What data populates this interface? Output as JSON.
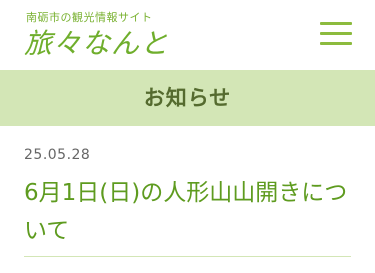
{
  "header": {
    "tagline": "南砺市の観光情報サイト",
    "logo_text": "旅々なんと",
    "menu_icon": "hamburger-menu-icon"
  },
  "section": {
    "title": "お知らせ"
  },
  "post": {
    "date": "25.05.28",
    "title": "6月1日(日)の人形山山開きについて"
  },
  "colors": {
    "brand_green": "#6fae2c",
    "band_green": "#d3e6b6",
    "title_green": "#5e9b1f",
    "section_text": "#556b2f",
    "date_gray": "#666666"
  }
}
